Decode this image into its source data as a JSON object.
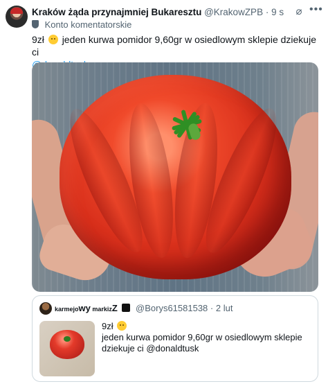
{
  "tweet": {
    "author_name": "Kraków żąda przynajmniej Bukaresztu",
    "handle": "@KrakowZPB",
    "separator": "·",
    "time": "9 s",
    "account_label": "Konto komentatorskie",
    "text_prefix": "9zł",
    "text_main": "jeden kurwa pomidor 9,60gr w osiedlowym sklepie  dziekuje ci",
    "mention": "@donaldtusk"
  },
  "quote": {
    "name_prefix": "karmejo",
    "name_big1": "wy",
    "name_middle": "markiz",
    "name_big2": "Z",
    "handle": "@Borys61581538",
    "separator": "·",
    "time": "2 lut",
    "line1": "9zł",
    "line2": "jeden kurwa pomidor 9,60gr w osiedlowym sklepie",
    "line3_prefix": "dziekuje ci ",
    "line3_mention": "@donaldtusk"
  },
  "icons": {
    "grok": "grok-icon",
    "more": "more-icon",
    "account": "account-icon",
    "emoji": "flushed-emoji-icon",
    "skull": "skull-icon"
  }
}
